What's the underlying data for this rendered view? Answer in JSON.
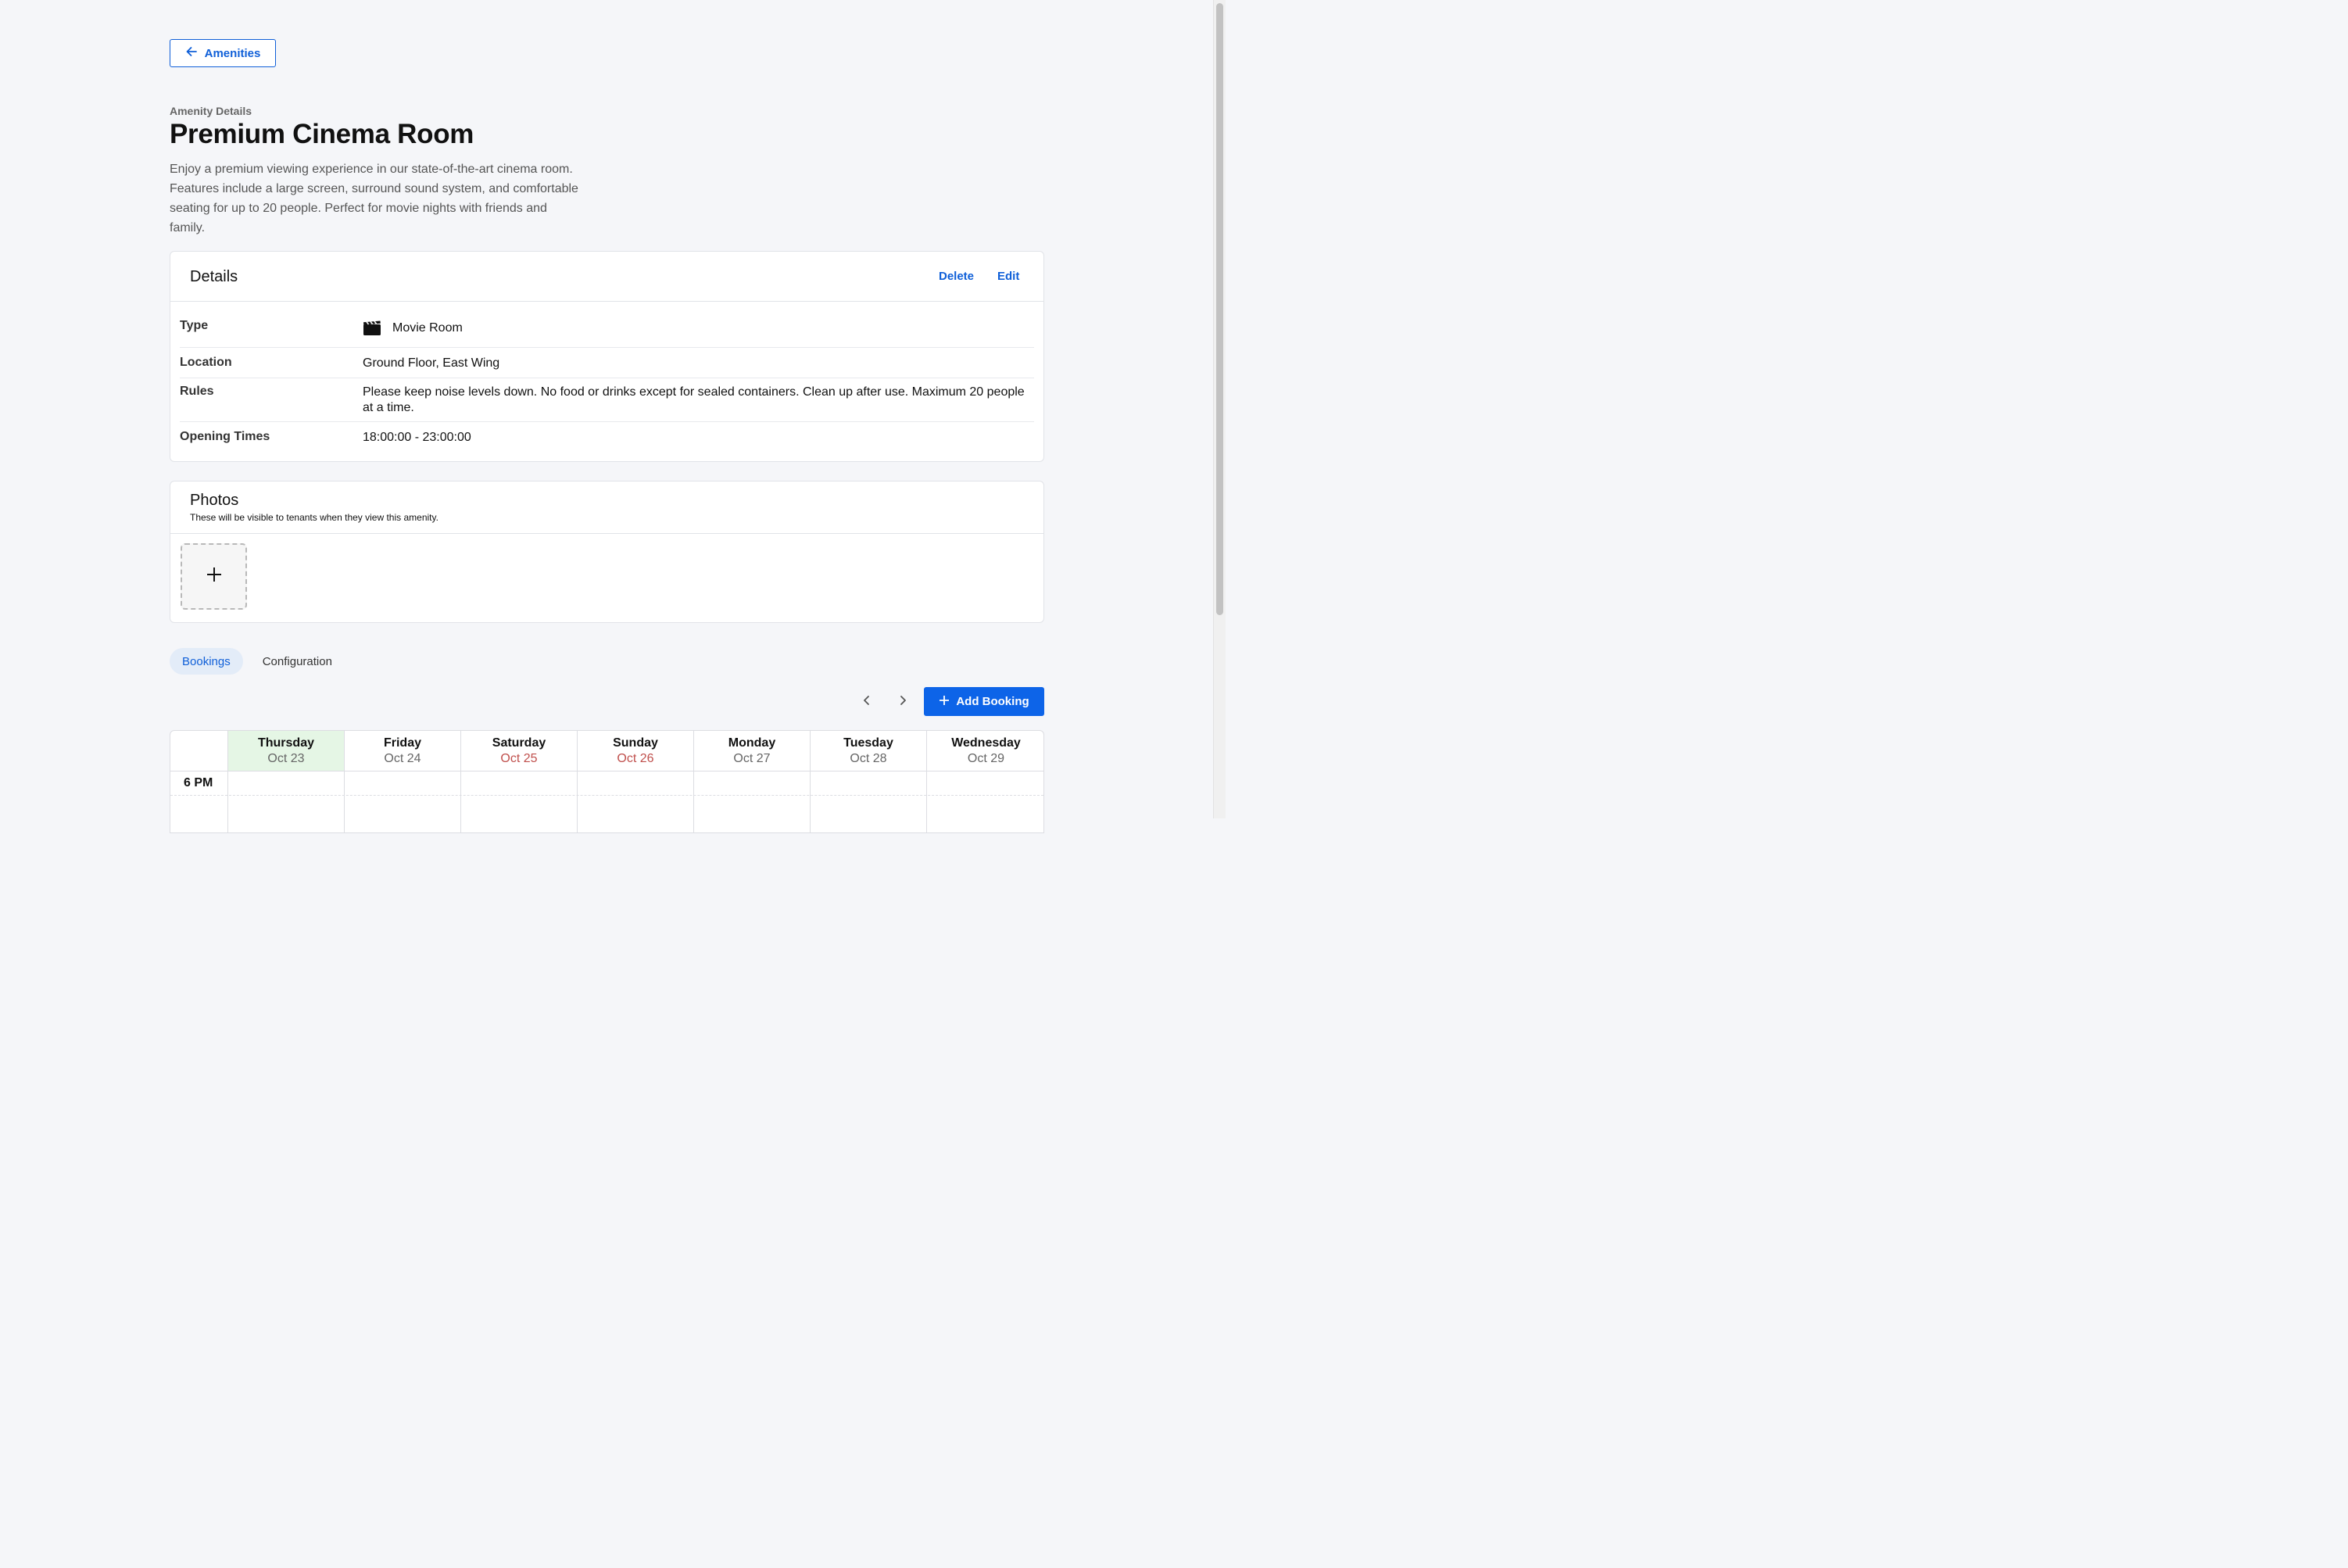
{
  "header": {
    "back_label": "Amenities"
  },
  "amenity": {
    "subheading": "Amenity Details",
    "title": "Premium Cinema Room",
    "description": "Enjoy a premium viewing experience in our state-of-the-art cinema room. Features include a large screen, surround sound system, and comfortable seating for up to 20 people. Perfect for movie nights with friends and family."
  },
  "details": {
    "title": "Details",
    "delete_label": "Delete",
    "edit_label": "Edit",
    "type_label": "Type",
    "type_value": "Movie Room",
    "type_icon": "clapperboard-icon",
    "location_label": "Location",
    "location_value": "Ground Floor, East Wing",
    "rules_label": "Rules",
    "rules_value": "Please keep noise levels down. No food or drinks except for sealed containers. Clean up after use. Maximum 20 people at a time.",
    "opening_label": "Opening Times",
    "opening_value": "18:00:00 - 23:00:00"
  },
  "photos": {
    "title": "Photos",
    "subtitle": "These will be visible to tenants when they view this amenity."
  },
  "tabs": [
    {
      "label": "Bookings",
      "active": true
    },
    {
      "label": "Configuration",
      "active": false
    }
  ],
  "bookings": {
    "add_label": "Add Booking",
    "days": [
      {
        "name": "Thursday",
        "date": "Oct 23",
        "today": true,
        "weekend": false
      },
      {
        "name": "Friday",
        "date": "Oct 24",
        "today": false,
        "weekend": false
      },
      {
        "name": "Saturday",
        "date": "Oct 25",
        "today": false,
        "weekend": true
      },
      {
        "name": "Sunday",
        "date": "Oct 26",
        "today": false,
        "weekend": true
      },
      {
        "name": "Monday",
        "date": "Oct 27",
        "today": false,
        "weekend": false
      },
      {
        "name": "Tuesday",
        "date": "Oct 28",
        "today": false,
        "weekend": false
      },
      {
        "name": "Wednesday",
        "date": "Oct 29",
        "today": false,
        "weekend": false
      }
    ],
    "time_slots": [
      "6 PM"
    ]
  },
  "colors": {
    "accent": "#0f5fd8",
    "today": "#e5f6e5",
    "weekend": "#c0504d"
  }
}
